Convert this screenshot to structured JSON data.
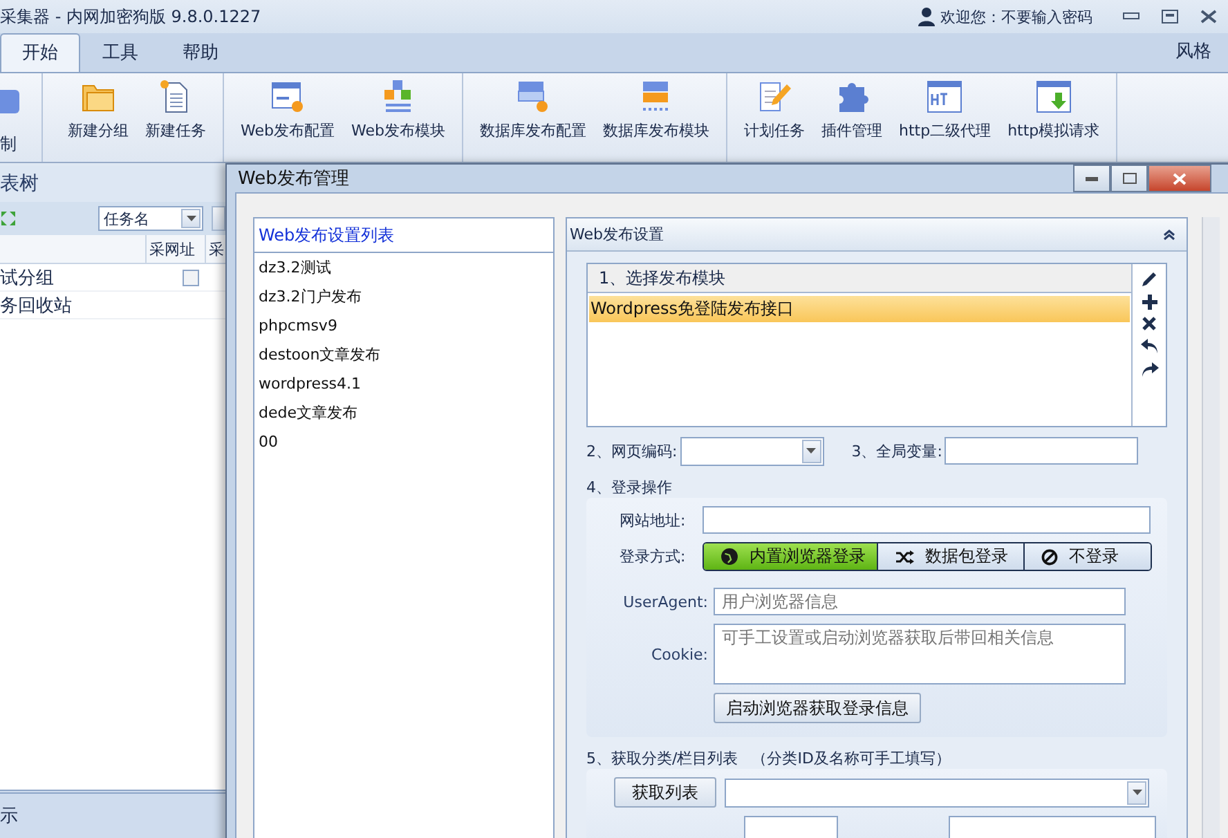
{
  "window": {
    "title": "采集器 - 内网加密狗版 9.8.0.1227",
    "welcome": "欢迎您：不要输入密码"
  },
  "ribbon_tabs": [
    {
      "label": "开始",
      "selected": true
    },
    {
      "label": "工具",
      "selected": false
    },
    {
      "label": "帮助",
      "selected": false
    }
  ],
  "style_menu": "风格",
  "toolbar": {
    "partial_label": "制",
    "groups": [
      [
        {
          "label": "新建分组",
          "kind": "folder"
        },
        {
          "label": "新建任务",
          "kind": "newdoc"
        }
      ],
      [
        {
          "label": "Web发布配置",
          "kind": "webconfig"
        },
        {
          "label": "Web发布模块",
          "kind": "webmodule"
        }
      ],
      [
        {
          "label": "数据库发布配置",
          "kind": "dbconfig"
        },
        {
          "label": "数据库发布模块",
          "kind": "dbmodule"
        }
      ],
      [
        {
          "label": "计划任务",
          "kind": "schedule"
        },
        {
          "label": "插件管理",
          "kind": "plugin"
        },
        {
          "label": "http二级代理",
          "kind": "proxy"
        },
        {
          "label": "http模拟请求",
          "kind": "request"
        }
      ]
    ]
  },
  "task_tree": {
    "title": "表树",
    "filter": "任务名",
    "columns": [
      "采网址",
      "采"
    ],
    "rows": [
      {
        "name": "试分组",
        "kind": "group",
        "checked": false
      },
      {
        "name": "务回收站",
        "kind": "bin"
      }
    ],
    "status": "示"
  },
  "dialog": {
    "title": "Web发布管理",
    "list_title": "Web发布设置列表",
    "list_items": [
      "dz3.2测试",
      "dz3.2门户发布",
      "phpcmsv9",
      "destoon文章发布",
      "wordpress4.1",
      "dede文章发布",
      "00"
    ],
    "settings_title": "Web发布设置",
    "module_header": "1、选择发布模块",
    "modules": [
      {
        "label": "Wordpress免登陆发布接口",
        "selected": true
      }
    ],
    "encoding_label": "2、网页编码:",
    "globals_label": "3、全局变量:",
    "login": {
      "title": "4、登录操作",
      "site_label": "网站地址:",
      "method_label": "登录方式:",
      "methods": [
        {
          "label": "内置浏览器登录",
          "selected": true,
          "kind": "browser"
        },
        {
          "label": "数据包登录",
          "selected": false,
          "kind": "packet"
        },
        {
          "label": "不登录",
          "selected": false,
          "kind": "none"
        }
      ],
      "ua_label": "UserAgent:",
      "ua_placeholder": "用户浏览器信息",
      "cookie_label": "Cookie:",
      "cookie_placeholder": "可手工设置或启动浏览器获取后带回相关信息",
      "launch_button": "启动浏览器获取登录信息"
    },
    "category": {
      "title": "5、获取分类/栏目列表",
      "note": "（分类ID及名称可手工填写）",
      "fetch_button": "获取列表"
    }
  }
}
